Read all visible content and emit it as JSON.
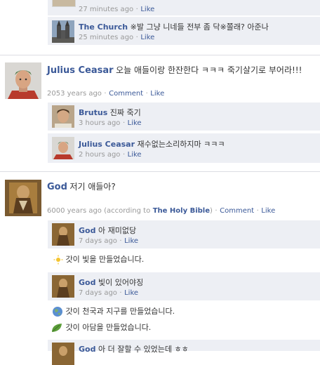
{
  "thread_top": {
    "comment1": {
      "time": "27 minutes ago",
      "like": "Like"
    },
    "comment2": {
      "name": "The Church",
      "text": "※발 그냥 니네들 전부 좀 닥※쫄래? 아준나",
      "time": "25 minutes ago",
      "like": "Like"
    }
  },
  "post_caesar": {
    "name": "Julius Ceasar",
    "text": "오늘 애들이랑 한잔한다 ㅋㅋㅋ 죽기살기로 부어라!!!",
    "time": "2053 years ago",
    "comment_link": "Comment",
    "like": "Like",
    "comments": [
      {
        "name": "Brutus",
        "text": "진짜 죽기",
        "time": "3 hours ago",
        "like": "Like"
      },
      {
        "name": "Julius Ceasar",
        "text": "재수없는소리하지마 ㅋㅋㅋ",
        "time": "2 hours ago",
        "like": "Like"
      }
    ]
  },
  "post_god": {
    "name": "God",
    "text": "저기 애들아?",
    "time": "6000 years ago (according to",
    "source": "The Holy Bible",
    "time_close": ")",
    "comment_link": "Comment",
    "like": "Like",
    "comment1": {
      "name": "God",
      "text": "아 재미없당",
      "time": "7 days ago",
      "like": "Like"
    },
    "event1": {
      "text": "갓이 빛을 만들었습니다."
    },
    "comment2": {
      "name": "God",
      "text": "빛이 있어야징",
      "time": "7 days ago",
      "like": "Like"
    },
    "event2": {
      "text": "갓이 천국과 지구를 만들었습니다."
    },
    "event3": {
      "text": "갓이 아담을 만들었습니다."
    },
    "comment3": {
      "name": "God",
      "text": "아 더 잘할 수 있었는데 ㅎㅎ"
    }
  },
  "separator": "·",
  "colors": {
    "link": "#3b5998",
    "comment_bg": "#edeff4",
    "meta": "#999999"
  }
}
